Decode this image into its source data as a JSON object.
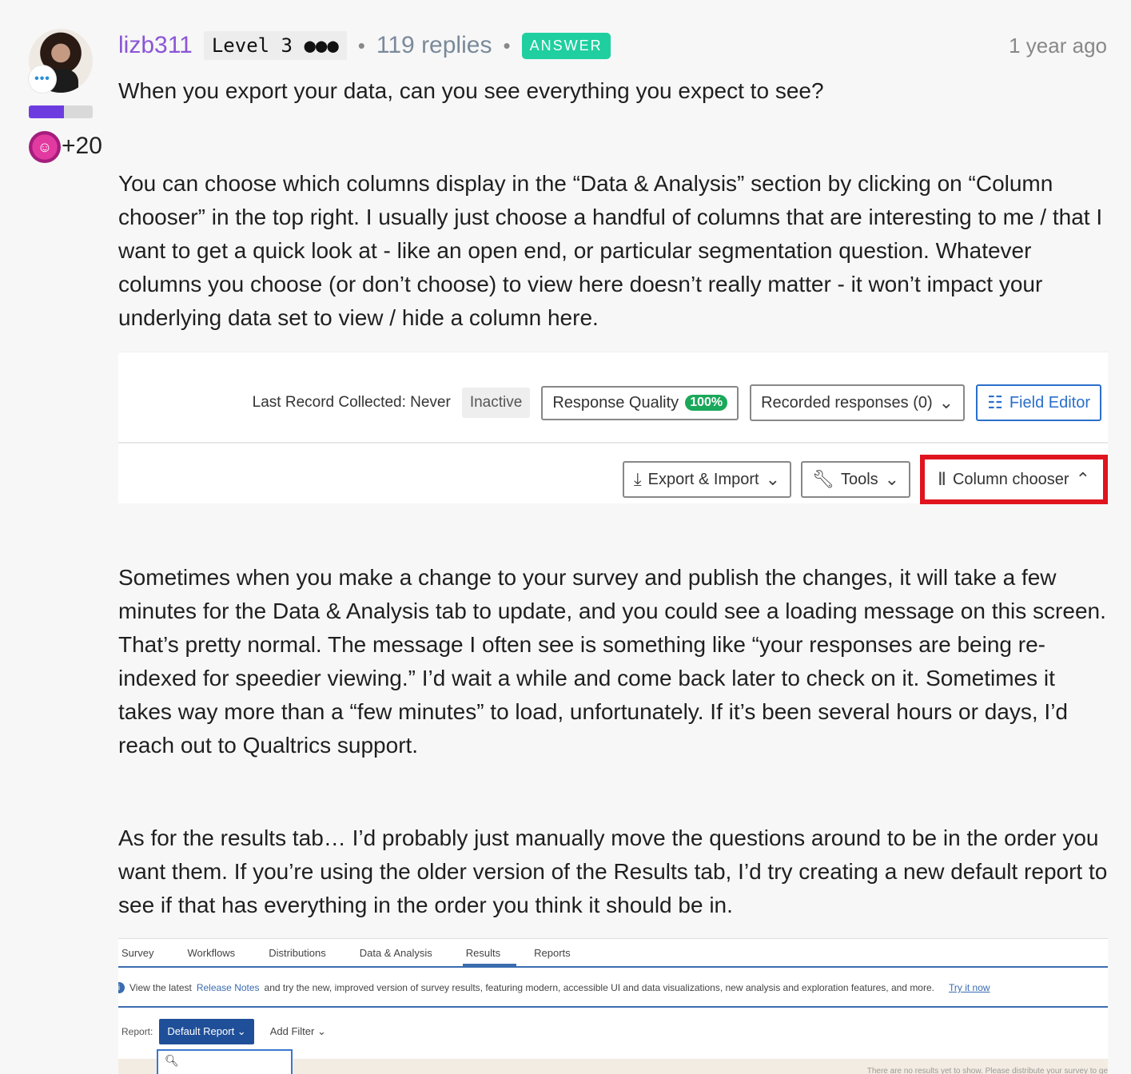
{
  "author": {
    "username": "lizb311",
    "level": "Level 3 ●●●",
    "replies": "119 replies",
    "answer_badge": "ANSWER",
    "time": "1 year ago",
    "avatar_badge": "•••",
    "rank_progress": 0.55,
    "reaction_count": "+20"
  },
  "post": {
    "p1": "When you export your data, can you see everything you expect to see?",
    "p2": "You can choose which columns display in the “Data & Analysis” section by clicking on “Column chooser” in the top right. I usually just choose a handful of columns that are interesting to me / that I want to get a quick look at - like an open end, or particular segmentation question. Whatever columns you choose (or don’t choose) to view here doesn’t really matter - it won’t impact your underlying data set to view / hide a column here.",
    "p3": "Sometimes when  you make a change to your survey and publish the changes, it will take a few minutes for the Data & Analysis tab to update, and you could see a loading message on this screen. That’s pretty normal. The message I often see is something like “your responses are being re-indexed for speedier viewing.” I’d wait a while and come back later to check on it. Sometimes it takes way more than a “few minutes” to load, unfortunately. If it’s been several hours or days, I’d reach out to Qualtrics support.",
    "p4": "As for the results tab… I’d probably just manually move the questions around to be in the order you want them. If you’re using the older version of the Results tab, I’d try creating a new default report to see if that has everything in the order you think it should be in."
  },
  "screenshot1": {
    "last_record": "Last Record Collected: Never",
    "status": "Inactive",
    "response_quality": "Response Quality",
    "quality_pill": "100%",
    "recorded": "Recorded responses (0)",
    "field_editor": "Field Editor",
    "export_import": "Export & Import",
    "tools": "Tools",
    "column_chooser": "Column chooser",
    "highlight_color": "#e0141e"
  },
  "screenshot2": {
    "tabs": [
      "Survey",
      "Workflows",
      "Distributions",
      "Data & Analysis",
      "Results",
      "Reports"
    ],
    "notice_pre": "View the latest",
    "notice_link": "Release Notes",
    "notice_post": "and try the new, improved version of survey results, featuring modern, accessible UI and data visualizations, new analysis and exploration features, and more.",
    "try_it": "Try it now",
    "report_label": "Report:",
    "report_value": "Default Report",
    "add_filter": "Add Filter",
    "no_results": "There are no results yet to show. Please distribute your survey to ge"
  }
}
